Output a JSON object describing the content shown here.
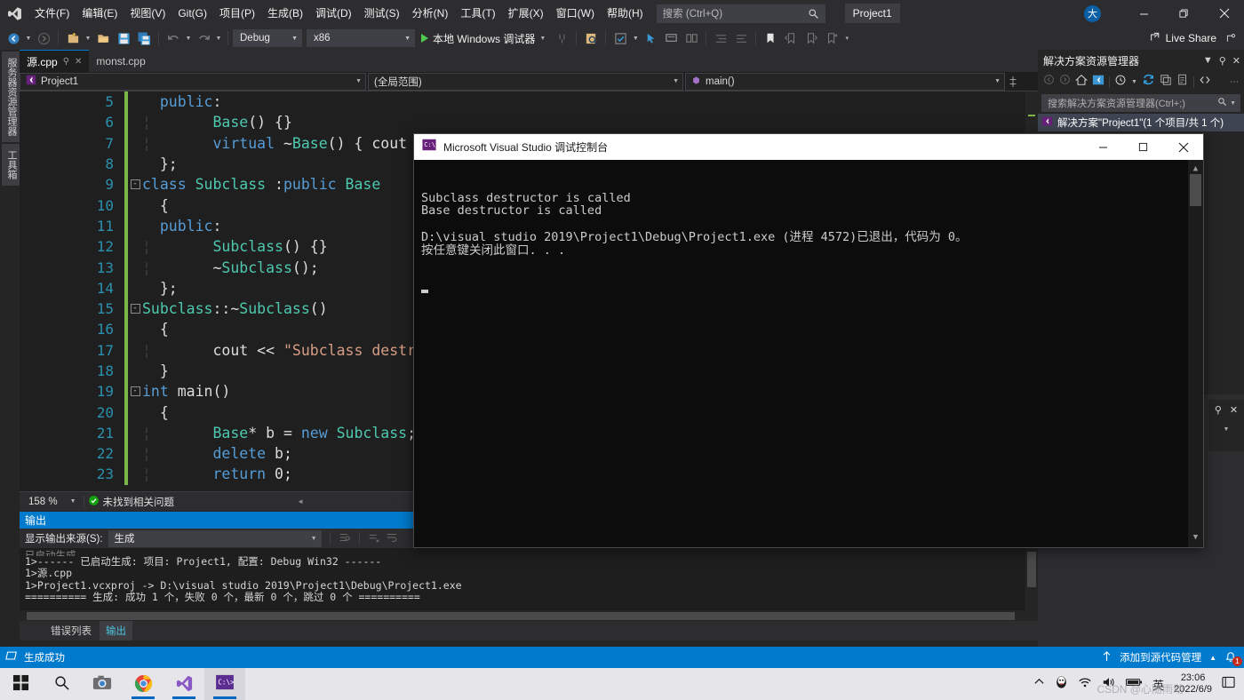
{
  "app": {
    "title": "Project1",
    "search_placeholder": "搜索 (Ctrl+Q)",
    "account_initial": "大",
    "live_share": "Live Share"
  },
  "menubar": {
    "items": [
      {
        "label": "文件(F)"
      },
      {
        "label": "编辑(E)"
      },
      {
        "label": "视图(V)"
      },
      {
        "label": "Git(G)"
      },
      {
        "label": "项目(P)"
      },
      {
        "label": "生成(B)"
      },
      {
        "label": "调试(D)"
      },
      {
        "label": "测试(S)"
      },
      {
        "label": "分析(N)"
      },
      {
        "label": "工具(T)"
      },
      {
        "label": "扩展(X)"
      },
      {
        "label": "窗口(W)"
      },
      {
        "label": "帮助(H)"
      }
    ]
  },
  "toolbar": {
    "configuration": "Debug",
    "platform": "x86",
    "run_label": "本地 Windows 调试器"
  },
  "left_dock": {
    "tabs": [
      "服务器资源管理器",
      "工具箱"
    ]
  },
  "editor": {
    "tabs": [
      {
        "label": "源.cpp",
        "active": true
      },
      {
        "label": "monst.cpp",
        "active": false
      }
    ],
    "nav": {
      "project": "Project1",
      "scope": "(全局范围)",
      "member": "main()"
    },
    "zoom": "158 %",
    "issues": "未找到相关问题",
    "lines": [
      {
        "n": "5",
        "modified": true,
        "fold": "",
        "indent": 1,
        "code": "public:"
      },
      {
        "n": "6",
        "modified": true,
        "fold": "",
        "indent": 2,
        "code": "Base() {}"
      },
      {
        "n": "7",
        "modified": true,
        "fold": "",
        "indent": 2,
        "code": "virtual ~Base() { cout << \"Ba"
      },
      {
        "n": "8",
        "modified": true,
        "fold": "",
        "indent": 1,
        "code": "};"
      },
      {
        "n": "9",
        "modified": true,
        "fold": "-",
        "indent": 0,
        "code": "class Subclass :public Base"
      },
      {
        "n": "10",
        "modified": true,
        "fold": "",
        "indent": 1,
        "code": "{"
      },
      {
        "n": "11",
        "modified": true,
        "fold": "",
        "indent": 1,
        "code": "public:"
      },
      {
        "n": "12",
        "modified": true,
        "fold": "",
        "indent": 2,
        "code": "Subclass() {}"
      },
      {
        "n": "13",
        "modified": true,
        "fold": "",
        "indent": 2,
        "code": "~Subclass();"
      },
      {
        "n": "14",
        "modified": true,
        "fold": "",
        "indent": 1,
        "code": "};"
      },
      {
        "n": "15",
        "modified": true,
        "fold": "-",
        "indent": 0,
        "code": "Subclass::~Subclass()"
      },
      {
        "n": "16",
        "modified": true,
        "fold": "",
        "indent": 1,
        "code": "{"
      },
      {
        "n": "17",
        "modified": true,
        "fold": "",
        "indent": 2,
        "code": "cout << \"Subclass destructor"
      },
      {
        "n": "18",
        "modified": true,
        "fold": "",
        "indent": 1,
        "code": "}"
      },
      {
        "n": "19",
        "modified": true,
        "fold": "-",
        "indent": 0,
        "code": "int main()"
      },
      {
        "n": "20",
        "modified": true,
        "fold": "",
        "indent": 1,
        "code": "{"
      },
      {
        "n": "21",
        "modified": true,
        "fold": "",
        "indent": 2,
        "code": "Base* b = new Subclass;"
      },
      {
        "n": "22",
        "modified": true,
        "fold": "",
        "indent": 2,
        "code": "delete b;"
      },
      {
        "n": "23",
        "modified": true,
        "fold": "",
        "indent": 2,
        "code": "return 0;"
      }
    ]
  },
  "output_panel": {
    "title": "输出",
    "source_label": "显示输出来源(S):",
    "source_value": "生成",
    "lines": [
      "已启动生成",
      "1>------ 已启动生成: 项目: Project1, 配置: Debug Win32 ------",
      "1>源.cpp",
      "1>Project1.vcxproj -> D:\\visual studio 2019\\Project1\\Debug\\Project1.exe",
      "========== 生成: 成功 1 个，失败 0 个，最新 0 个，跳过 0 个 =========="
    ],
    "tabs": [
      {
        "label": "错误列表",
        "active": false
      },
      {
        "label": "输出",
        "active": true
      }
    ]
  },
  "solution_explorer": {
    "title": "解决方案资源管理器",
    "search_placeholder": "搜索解决方案资源管理器(Ctrl+;)",
    "root_node": "解决方案\"Project1\"(1 个项目/共 1 个)"
  },
  "status_bar": {
    "build_status": "生成成功",
    "source_control": "添加到源代码管理",
    "notification_count": "1"
  },
  "console_window": {
    "title": "Microsoft Visual Studio 调试控制台",
    "lines": [
      "Subclass destructor is called",
      "Base destructor is called",
      "",
      "D:\\visual studio 2019\\Project1\\Debug\\Project1.exe (进程 4572)已退出，代码为 0。",
      "按任意键关闭此窗口. . ."
    ]
  },
  "taskbar": {
    "items": [
      {
        "name": "start-button"
      },
      {
        "name": "search"
      },
      {
        "name": "camera"
      },
      {
        "name": "chrome"
      },
      {
        "name": "visual-studio"
      },
      {
        "name": "console"
      }
    ],
    "ime": "英",
    "time": "23:06",
    "date": "2022/6/9",
    "watermark": "CSDN @心随雨动"
  },
  "colors": {
    "accent": "#007acc",
    "chrome": "#2d2d30",
    "editor_bg": "#1f1f1f",
    "console_bg": "#0c0c0c"
  }
}
